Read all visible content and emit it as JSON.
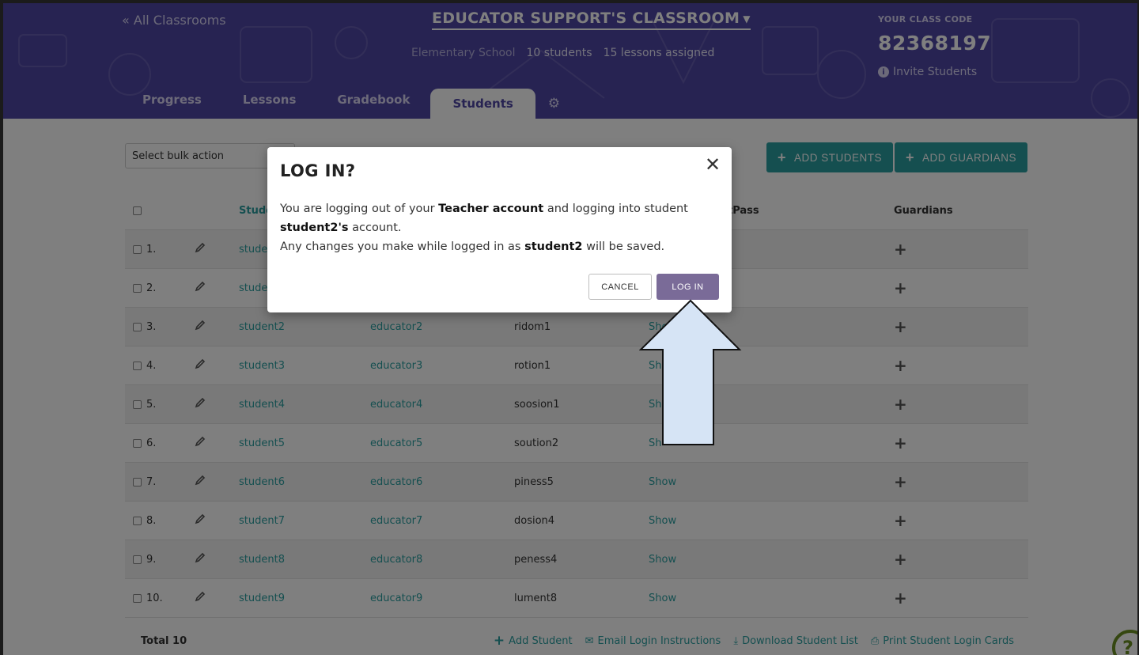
{
  "header": {
    "all_classrooms": "« All Classrooms",
    "class_title": "EDUCATOR SUPPORT'S CLASSROOM",
    "school": "Elementary School",
    "students_count": "10 students",
    "lessons_assigned": "15 lessons assigned",
    "code_label": "YOUR CLASS CODE",
    "code_value": "82368197",
    "invite": "Invite Students"
  },
  "tabs": [
    {
      "label": "Progress"
    },
    {
      "label": "Lessons"
    },
    {
      "label": "Gradebook"
    },
    {
      "label": "Students",
      "active": true
    }
  ],
  "toolbar": {
    "bulk_placeholder": "Select bulk action",
    "add_students": "ADD STUDENTS",
    "add_guardians": "ADD GUARDIANS"
  },
  "table": {
    "headers": {
      "student": "Stude",
      "password": "tPass",
      "guardians": "Guardians"
    },
    "rows": [
      {
        "num": "1.",
        "user": "stude",
        "educator": "",
        "password": "",
        "show": ""
      },
      {
        "num": "2.",
        "user": "stude",
        "educator": "",
        "password": "",
        "show": ""
      },
      {
        "num": "3.",
        "user": "student2",
        "educator": "educator2",
        "password": "ridom1",
        "show": "Sho"
      },
      {
        "num": "4.",
        "user": "student3",
        "educator": "educator3",
        "password": "rotion1",
        "show": "Sho"
      },
      {
        "num": "5.",
        "user": "student4",
        "educator": "educator4",
        "password": "soosion1",
        "show": "Sh"
      },
      {
        "num": "6.",
        "user": "student5",
        "educator": "educator5",
        "password": "soution2",
        "show": "Sh"
      },
      {
        "num": "7.",
        "user": "student6",
        "educator": "educator6",
        "password": "piness5",
        "show": "Show"
      },
      {
        "num": "8.",
        "user": "student7",
        "educator": "educator7",
        "password": "dosion4",
        "show": "Show"
      },
      {
        "num": "9.",
        "user": "student8",
        "educator": "educator8",
        "password": "peness4",
        "show": "Show"
      },
      {
        "num": "10.",
        "user": "student9",
        "educator": "educator9",
        "password": "lument8",
        "show": "Show"
      }
    ],
    "guardian_symbol": "+"
  },
  "footer": {
    "total": "Total 10",
    "add_student": "Add Student",
    "email_login": "Email Login Instructions",
    "download_list": "Download Student List",
    "print_cards": "Print Student Login Cards"
  },
  "modal": {
    "title": "LOG IN?",
    "close": "✕",
    "line1_a": "You are logging out of your ",
    "line1_b": "Teacher account",
    "line1_c": " and logging into student",
    "line2_b": "student2's",
    "line2_c": " account.",
    "line3_a": "Any changes you make while logged in as ",
    "line3_b": "student2",
    "line3_c": " will be saved.",
    "cancel": "CANCEL",
    "login": "LOG IN"
  },
  "help": "?",
  "colors": {
    "header_bg": "#4f46a5",
    "teal": "#2a9fa0",
    "login_btn": "#7a6b98",
    "arrow_fill": "#d6e4f5"
  }
}
